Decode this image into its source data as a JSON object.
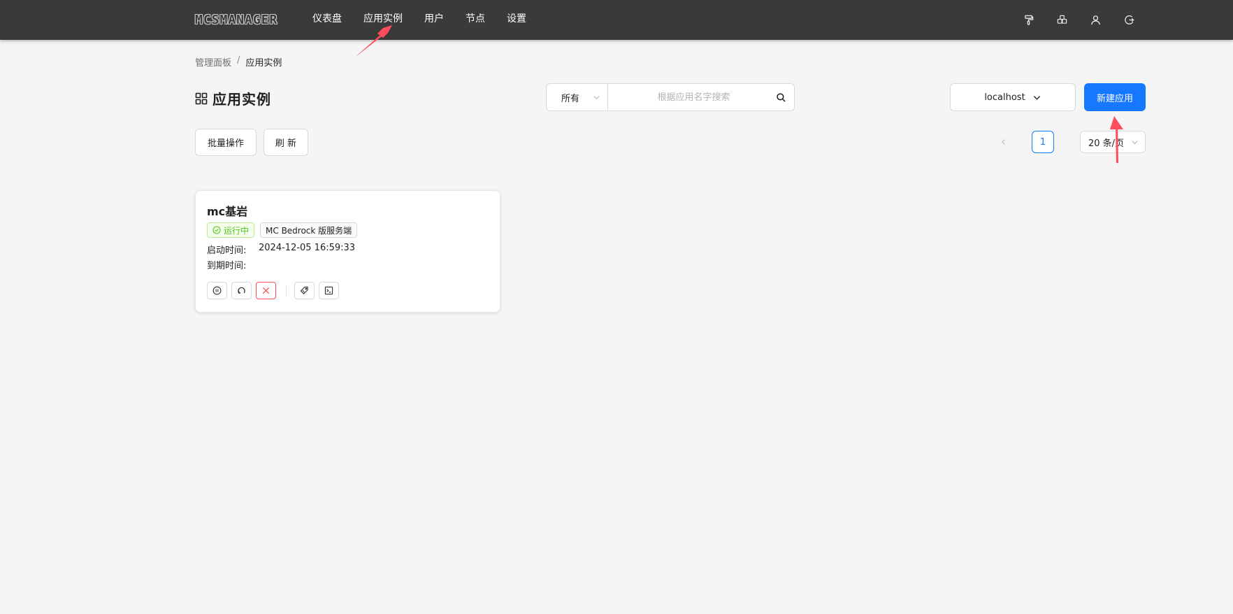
{
  "header": {
    "logo": "MCSMANAGER",
    "nav": [
      {
        "label": "仪表盘"
      },
      {
        "label": "应用实例"
      },
      {
        "label": "用户"
      },
      {
        "label": "节点"
      },
      {
        "label": "设置"
      }
    ],
    "icons": [
      "paint-roller-icon",
      "cubes-icon",
      "user-icon",
      "logout-icon"
    ]
  },
  "breadcrumb": {
    "parent": "管理面板",
    "separator": "/",
    "current": "应用实例"
  },
  "page": {
    "title": "应用实例"
  },
  "filter": {
    "selected": "所有",
    "search_placeholder": "根据应用名字搜索",
    "search_value": ""
  },
  "node_select": {
    "selected": "localhost"
  },
  "actions": {
    "create_label": "新建应用",
    "batch_label": "批量操作",
    "refresh_label": "刷 新"
  },
  "pagination": {
    "current_page": "1",
    "page_size": "20 条/页"
  },
  "instance": {
    "name": "mc基岩",
    "status": "运行中",
    "type": "MC Bedrock 版服务端",
    "start_label": "启动时间:",
    "start_value": "2024-12-05 16:59:33",
    "expire_label": "到期时间:",
    "expire_value": "",
    "buttons": [
      "stop-icon",
      "restart-icon",
      "kill-icon",
      "tag-icon",
      "terminal-icon"
    ]
  },
  "colors": {
    "header_bg": "#3a3a3a",
    "page_bg": "#f5f5f5",
    "primary": "#1677ff",
    "success": "#52c41a",
    "danger": "#ff4d4f",
    "annotation": "#ff4d5e"
  }
}
